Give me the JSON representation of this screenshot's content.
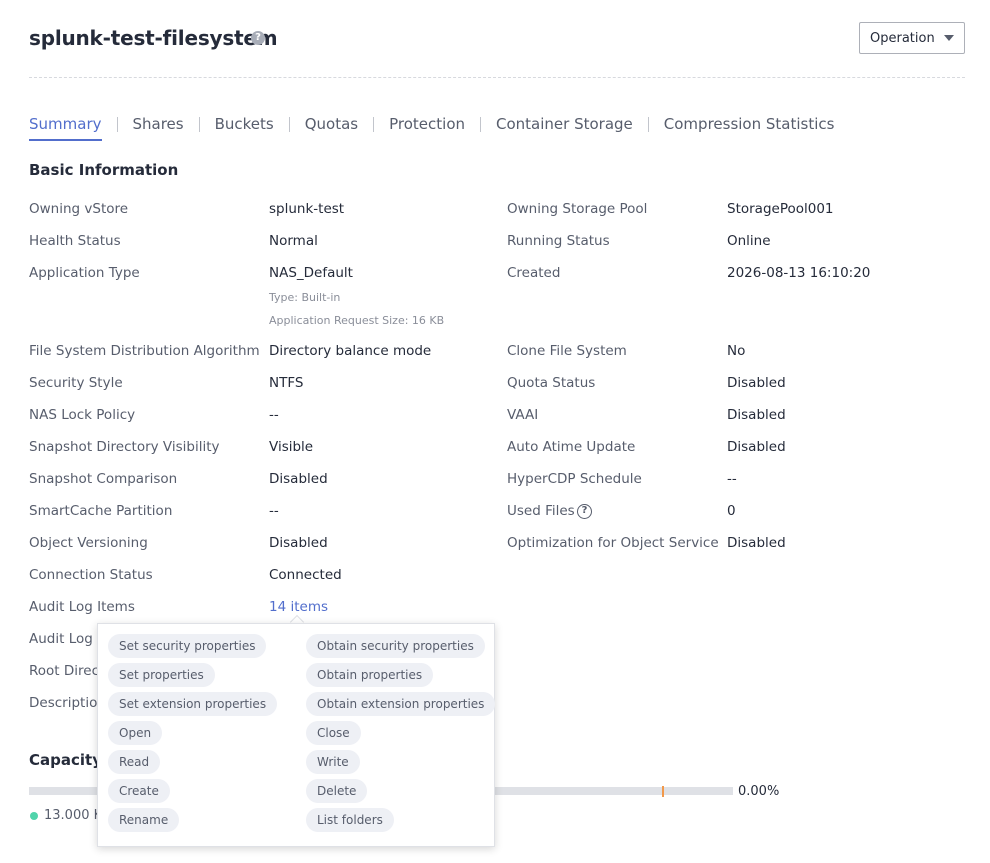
{
  "header": {
    "title": "splunk-test-filesystem",
    "help_icon": "?",
    "operation_label": "Operation"
  },
  "tabs": [
    {
      "label": "Summary",
      "active": true
    },
    {
      "label": "Shares"
    },
    {
      "label": "Buckets"
    },
    {
      "label": "Quotas"
    },
    {
      "label": "Protection"
    },
    {
      "label": "Container Storage"
    },
    {
      "label": "Compression Statistics"
    }
  ],
  "basic_info": {
    "title": "Basic Information",
    "owning_vstore": {
      "label": "Owning vStore",
      "value": "splunk-test"
    },
    "health_status": {
      "label": "Health Status",
      "value": "Normal"
    },
    "application_type": {
      "label": "Application Type",
      "value": "NAS_Default",
      "type_note": "Type: Built-in",
      "request_size_note": "Application Request Size: 16 KB"
    },
    "distribution_algorithm": {
      "label": "File System Distribution Algorithm",
      "value": "Directory balance mode"
    },
    "security_style": {
      "label": "Security Style",
      "value": "NTFS"
    },
    "nas_lock_policy": {
      "label": "NAS Lock Policy",
      "value": "--"
    },
    "snapshot_dir_visibility": {
      "label": "Snapshot Directory Visibility",
      "value": "Visible"
    },
    "snapshot_comparison": {
      "label": "Snapshot Comparison",
      "value": "Disabled"
    },
    "smartcache_partition": {
      "label": "SmartCache Partition",
      "value": "--"
    },
    "object_versioning": {
      "label": "Object Versioning",
      "value": "Disabled"
    },
    "connection_status": {
      "label": "Connection Status",
      "value": "Connected"
    },
    "audit_log_items": {
      "label": "Audit Log Items",
      "value": "14 items"
    },
    "audit_log_partial": {
      "label": "Audit Log I"
    },
    "root_dir_partial": {
      "label": "Root Direct"
    },
    "description_partial": {
      "label": "Descriptio"
    },
    "owning_pool": {
      "label": "Owning Storage Pool",
      "value": "StoragePool001"
    },
    "running_status": {
      "label": "Running Status",
      "value": "Online"
    },
    "created": {
      "label": "Created",
      "value": "2026-08-13 16:10:20"
    },
    "clone_fs": {
      "label": "Clone File System",
      "value": "No"
    },
    "quota_status": {
      "label": "Quota Status",
      "value": "Disabled"
    },
    "vaai": {
      "label": "VAAI",
      "value": "Disabled"
    },
    "auto_atime": {
      "label": "Auto Atime Update",
      "value": "Disabled"
    },
    "hypercdp": {
      "label": "HyperCDP Schedule",
      "value": "--"
    },
    "used_files": {
      "label": "Used Files",
      "value": "0",
      "icon": "?"
    },
    "object_optimization": {
      "label": "Optimization for Object Service",
      "value": "Disabled"
    }
  },
  "capacity": {
    "title_partial": "Capacity",
    "usage_fraction": 0.0,
    "percent_label": "0.00%",
    "legend_partial": "13.000 K",
    "usage_dot_color": "#50d4ab",
    "marker_color": "#f2994a"
  },
  "audit_popover": {
    "items": [
      "Set security properties",
      "Obtain security properties",
      "Set properties",
      "Obtain properties",
      "Set extension properties",
      "Obtain extension properties",
      "Open",
      "Close",
      "Read",
      "Write",
      "Create",
      "Delete",
      "Rename",
      "List folders"
    ]
  },
  "colors": {
    "accent": "#526ecc",
    "text": "#252b3a",
    "label": "#575d6c"
  }
}
